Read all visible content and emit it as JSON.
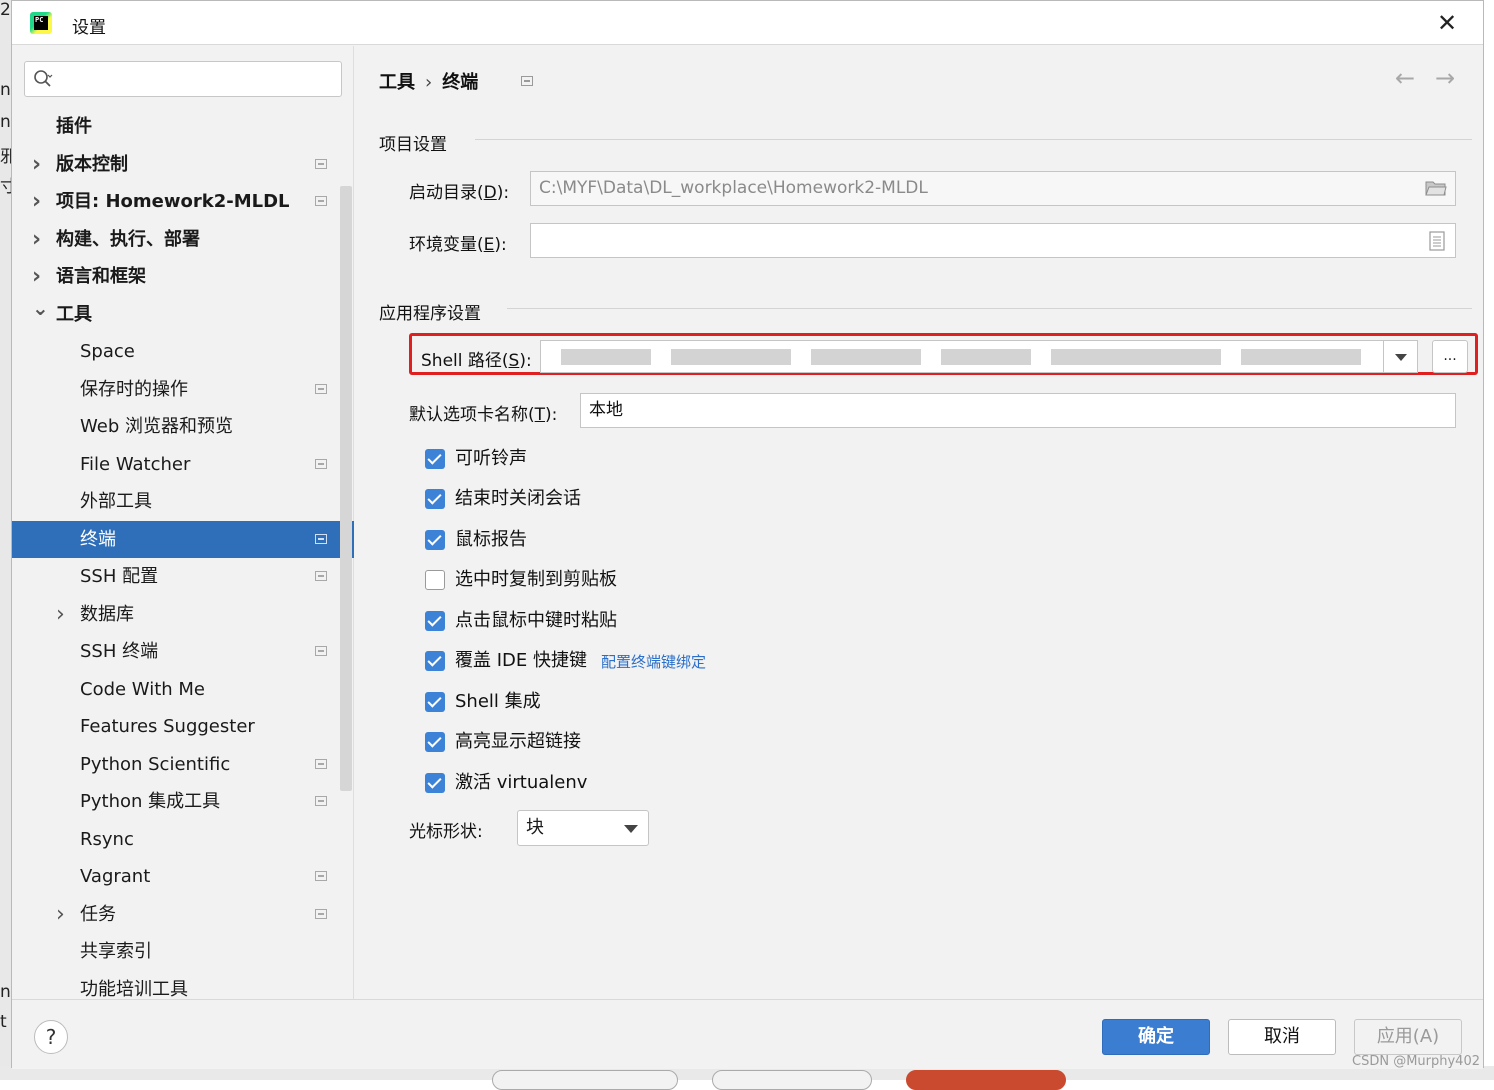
{
  "window": {
    "title": "设置"
  },
  "sidebar": {
    "items": [
      {
        "label": "插件",
        "bold": true,
        "indent": 0,
        "chevron": "",
        "proj": false
      },
      {
        "label": "版本控制",
        "bold": true,
        "indent": 0,
        "chevron": "right",
        "proj": true
      },
      {
        "label": "项目: Homework2-MLDL",
        "bold": true,
        "indent": 0,
        "chevron": "right",
        "proj": true
      },
      {
        "label": "构建、执行、部署",
        "bold": true,
        "indent": 0,
        "chevron": "right",
        "proj": false
      },
      {
        "label": "语言和框架",
        "bold": true,
        "indent": 0,
        "chevron": "right",
        "proj": false
      },
      {
        "label": "工具",
        "bold": true,
        "indent": 0,
        "chevron": "down",
        "proj": false
      },
      {
        "label": "Space",
        "bold": false,
        "indent": 1,
        "chevron": "",
        "proj": false
      },
      {
        "label": "保存时的操作",
        "bold": false,
        "indent": 1,
        "chevron": "",
        "proj": true
      },
      {
        "label": "Web 浏览器和预览",
        "bold": false,
        "indent": 1,
        "chevron": "",
        "proj": false
      },
      {
        "label": "File Watcher",
        "bold": false,
        "indent": 1,
        "chevron": "",
        "proj": true
      },
      {
        "label": "外部工具",
        "bold": false,
        "indent": 1,
        "chevron": "",
        "proj": false
      },
      {
        "label": "终端",
        "bold": false,
        "indent": 1,
        "chevron": "",
        "proj": true,
        "selected": true
      },
      {
        "label": "SSH 配置",
        "bold": false,
        "indent": 1,
        "chevron": "",
        "proj": true
      },
      {
        "label": "数据库",
        "bold": false,
        "indent": 1,
        "chevron": "right",
        "proj": false
      },
      {
        "label": "SSH 终端",
        "bold": false,
        "indent": 1,
        "chevron": "",
        "proj": true
      },
      {
        "label": "Code With Me",
        "bold": false,
        "indent": 1,
        "chevron": "",
        "proj": false
      },
      {
        "label": "Features Suggester",
        "bold": false,
        "indent": 1,
        "chevron": "",
        "proj": false
      },
      {
        "label": "Python Scientific",
        "bold": false,
        "indent": 1,
        "chevron": "",
        "proj": true
      },
      {
        "label": "Python 集成工具",
        "bold": false,
        "indent": 1,
        "chevron": "",
        "proj": true
      },
      {
        "label": "Rsync",
        "bold": false,
        "indent": 1,
        "chevron": "",
        "proj": false
      },
      {
        "label": "Vagrant",
        "bold": false,
        "indent": 1,
        "chevron": "",
        "proj": true
      },
      {
        "label": "任务",
        "bold": false,
        "indent": 1,
        "chevron": "right",
        "proj": true
      },
      {
        "label": "共享索引",
        "bold": false,
        "indent": 1,
        "chevron": "",
        "proj": false
      },
      {
        "label": "功能培训工具",
        "bold": false,
        "indent": 1,
        "chevron": "",
        "proj": false
      }
    ]
  },
  "breadcrumb": {
    "parent": "工具",
    "sep": "›",
    "current": "终端"
  },
  "project_section": {
    "title": "项目设置",
    "start_dir_label": "启动目录(",
    "start_dir_key": "D",
    "start_dir_label_end": "):",
    "start_dir_value": "C:\\MYF\\Data\\DL_workplace\\Homework2-MLDL",
    "env_label": "环境变量(",
    "env_key": "E",
    "env_label_end": "):",
    "env_value": ""
  },
  "app_section": {
    "title": "应用程序设置",
    "shell_label": "Shell 路径(",
    "shell_key": "S",
    "shell_label_end": "):",
    "browse_label": "...",
    "tab_name_label": "默认选项卡名称(",
    "tab_name_key": "T",
    "tab_name_label_end": "):",
    "tab_name_value": "本地",
    "checkboxes": [
      {
        "label": "可听铃声",
        "checked": true
      },
      {
        "label": "结束时关闭会话",
        "checked": true
      },
      {
        "label": "鼠标报告",
        "checked": true
      },
      {
        "label": "选中时复制到剪贴板",
        "checked": false
      },
      {
        "label": "点击鼠标中键时粘贴",
        "checked": true
      },
      {
        "label": "覆盖 IDE 快捷键",
        "checked": true
      },
      {
        "label": "Shell 集成",
        "checked": true
      },
      {
        "label": "高亮显示超链接",
        "checked": true
      },
      {
        "label": "激活 virtualenv",
        "checked": true
      }
    ],
    "keybinding_link": "配置终端键绑定",
    "cursor_label": "光标形状:",
    "cursor_value": "块"
  },
  "footer": {
    "help": "?",
    "ok": "确定",
    "cancel": "取消",
    "apply": "应用(A)"
  },
  "watermark": "CSDN @Murphy402",
  "colors": {
    "accent": "#3a7dd1",
    "selected": "#2f6fb9",
    "highlight_border": "#e02020",
    "link": "#2a6fc9"
  }
}
